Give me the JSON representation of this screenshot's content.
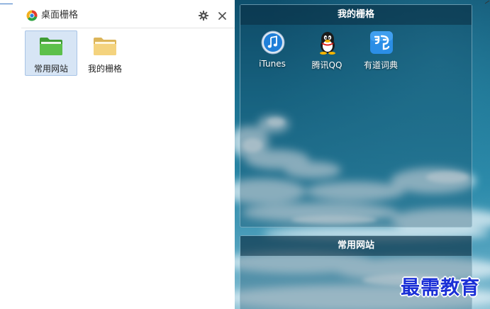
{
  "window": {
    "title": "桌面栅格"
  },
  "left_items": [
    {
      "label": "常用网站",
      "selected": true
    },
    {
      "label": "我的栅格",
      "selected": false
    }
  ],
  "fences": {
    "mine": {
      "title": "我的栅格",
      "apps": [
        {
          "label": "iTunes",
          "icon": "itunes-icon"
        },
        {
          "label": "腾讯QQ",
          "icon": "qq-penguin-icon"
        },
        {
          "label": "有道词典",
          "icon": "youdao-dictionary-icon"
        }
      ]
    },
    "common": {
      "title": "常用网站"
    }
  },
  "watermark": {
    "text": "最需教育"
  },
  "colors": {
    "sky_dark": "#0e4f6d",
    "sky_light": "#8ec3d6",
    "selection_bg": "#d7e5f5",
    "watermark": "#1a2fd6"
  }
}
